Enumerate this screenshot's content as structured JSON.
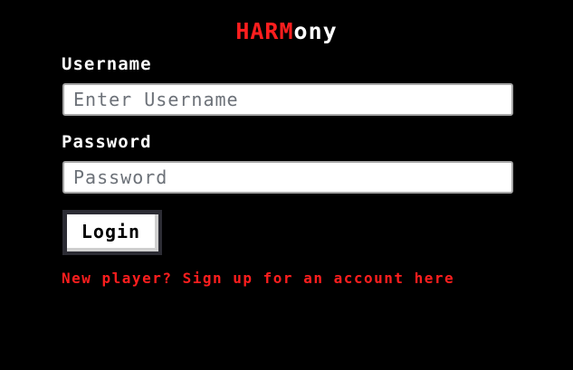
{
  "header": {
    "title_red": "HARM",
    "title_white": "ony"
  },
  "form": {
    "username_label": "Username",
    "username_placeholder": "Enter Username",
    "password_label": "Password",
    "password_placeholder": "Password",
    "login_label": "Login",
    "signup_link": "New player? Sign up for an account here"
  },
  "colors": {
    "accent_red": "#ff1e1e",
    "background": "#000000",
    "text": "#ffffff"
  }
}
